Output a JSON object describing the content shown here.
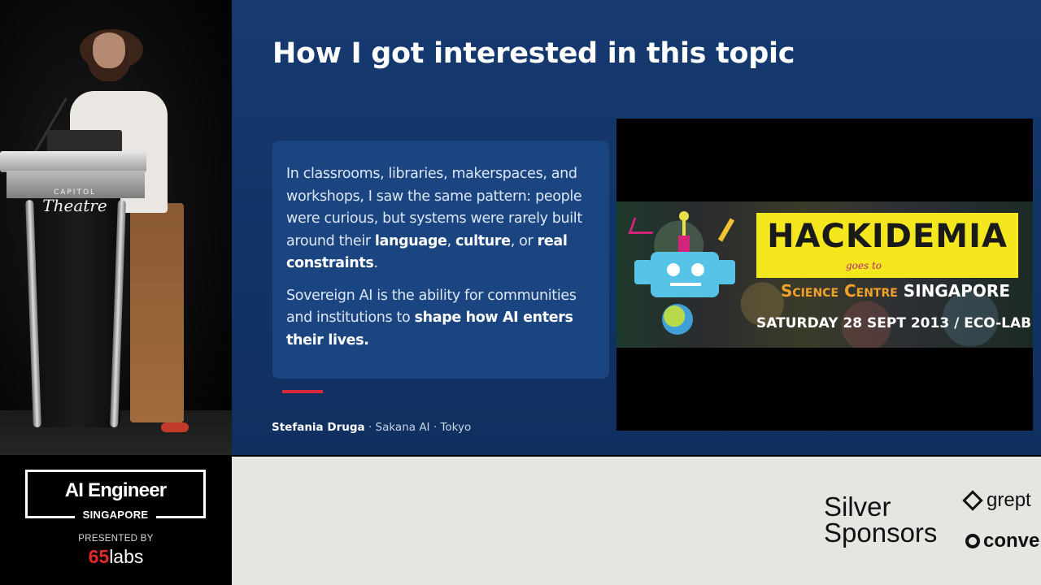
{
  "slide": {
    "title": "How I got interested in this topic",
    "paragraph1": {
      "lead": "In classrooms, libraries, makerspaces, and workshops, I saw the same pattern: people were curious, but systems were rarely built around their ",
      "bold1": "language",
      "sep1": ", ",
      "bold2": "culture",
      "sep2": ", or ",
      "bold3": "real constraints",
      "end": "."
    },
    "paragraph2": {
      "lead": "Sovereign AI is the ability for communities and institutions to ",
      "bold": "shape how AI enters their lives."
    },
    "credit": {
      "name": "Stefania Druga",
      "rest": " · Sakana AI · Tokyo"
    },
    "video": {
      "banner": "HACKIDEMIA",
      "goes_to": "goes to",
      "venue_a": "Science Centre",
      "venue_b": "SINGAPORE",
      "date": "SATURDAY  28 SEPT 2013 / ECO-LAB"
    }
  },
  "camera": {
    "podium_brand_top": "CAPITOL",
    "podium_brand_script": "Theatre"
  },
  "branding": {
    "event_name": "AI Engineer",
    "event_city": "SINGAPORE",
    "presented_by": "PRESENTED BY",
    "presenter_num": "65",
    "presenter_word": "labs"
  },
  "sponsors": {
    "tier_line1": "Silver",
    "tier_line2": "Sponsors",
    "logo1": "grept",
    "logo2": "conve"
  },
  "colors": {
    "slide_bg": "#123467",
    "card_bg": "#1b4580",
    "accent_red": "#d8283a",
    "banner_yellow": "#f5e71e",
    "sponsor_bg": "#e6e5e1"
  }
}
